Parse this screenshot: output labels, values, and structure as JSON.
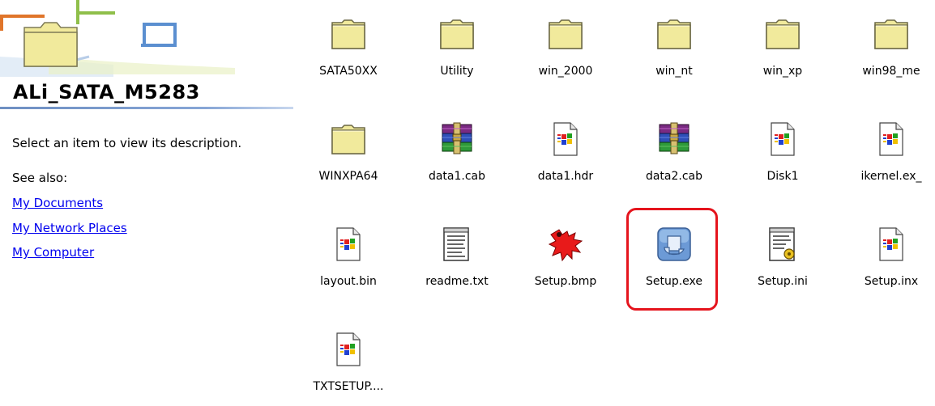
{
  "task_pane": {
    "title": "ALi_SATA_M5283",
    "description": "Select an item to view its description.",
    "see_also_label": "See also:",
    "links": [
      "My Documents",
      "My Network Places",
      "My Computer"
    ]
  },
  "files": [
    {
      "name": "SATA50XX",
      "icon": "folder-icon"
    },
    {
      "name": "Utility",
      "icon": "folder-icon"
    },
    {
      "name": "win_2000",
      "icon": "folder-icon"
    },
    {
      "name": "win_nt",
      "icon": "folder-icon"
    },
    {
      "name": "win_xp",
      "icon": "folder-icon"
    },
    {
      "name": "win98_me",
      "icon": "folder-icon"
    },
    {
      "name": "WINXPA64",
      "icon": "folder-icon"
    },
    {
      "name": "data1.cab",
      "icon": "winrar-archive-icon"
    },
    {
      "name": "data1.hdr",
      "icon": "windows-file-icon"
    },
    {
      "name": "data2.cab",
      "icon": "winrar-archive-icon"
    },
    {
      "name": "Disk1",
      "icon": "windows-file-icon"
    },
    {
      "name": "ikernel.ex_",
      "icon": "windows-file-icon"
    },
    {
      "name": "layout.bin",
      "icon": "windows-file-icon"
    },
    {
      "name": "readme.txt",
      "icon": "text-file-icon"
    },
    {
      "name": "Setup.bmp",
      "icon": "paint-splat-icon"
    },
    {
      "name": "Setup.exe",
      "icon": "setup-installer-icon"
    },
    {
      "name": "Setup.ini",
      "icon": "ini-settings-file-icon"
    },
    {
      "name": "Setup.inx",
      "icon": "windows-file-icon"
    },
    {
      "name": "TXTSETUP....",
      "icon": "windows-file-icon"
    }
  ],
  "highlighted_file": "Setup.exe",
  "colors": {
    "link": "#0000ee",
    "highlight_border": "#e5141d",
    "folder_fill": "#f1ea9c",
    "title_rule": "#6e8fc2"
  }
}
